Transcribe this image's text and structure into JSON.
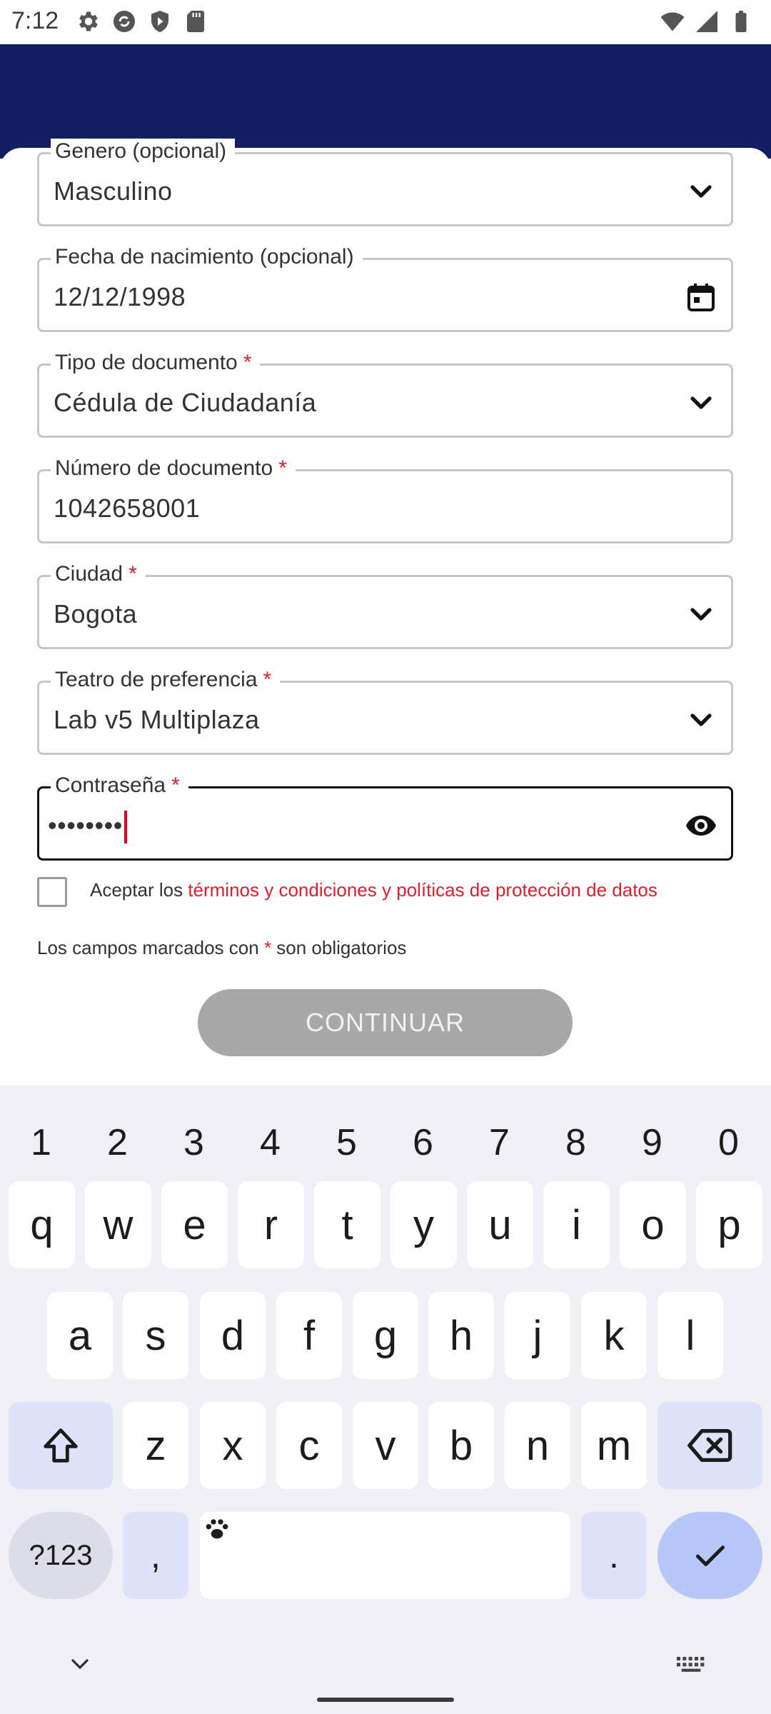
{
  "status_bar": {
    "time": "7:12",
    "left_icons": [
      "settings-icon",
      "sync-icon",
      "shield-icon",
      "sd-card-icon"
    ],
    "right_icons": [
      "wifi-icon",
      "signal-icon",
      "battery-icon"
    ]
  },
  "colors": {
    "header": "#121f63",
    "required": "#e11e2b",
    "button_disabled": "#a8a8a8"
  },
  "form": {
    "fields": [
      {
        "label": "Genero (opcional)",
        "required": false,
        "value": "Masculino",
        "icon": "chevron-down-icon"
      },
      {
        "label": "Fecha de nacimiento (opcional)",
        "required": false,
        "value": "12/12/1998",
        "icon": "calendar-icon"
      },
      {
        "label": "Tipo de documento",
        "required": true,
        "value": "Cédula de Ciudadanía",
        "icon": "chevron-down-icon"
      },
      {
        "label": "Número de documento",
        "required": true,
        "value": "1042658001",
        "icon": ""
      },
      {
        "label": "Ciudad",
        "required": true,
        "value": "Bogota",
        "icon": "chevron-down-icon"
      },
      {
        "label": "Teatro de preferencia",
        "required": true,
        "value": "Lab v5 Multiplaza",
        "icon": "chevron-down-icon"
      },
      {
        "label": "Contraseña",
        "required": true,
        "value": "••••••••",
        "icon": "eye-icon"
      }
    ],
    "required_mark": "*",
    "terms_prefix": "Aceptar los ",
    "terms_link": "términos y condiciones y políticas de protección de datos",
    "terms_checked": false,
    "note_prefix": "Los campos marcados con ",
    "note_suffix": " son obligatorios",
    "continue_label": "CONTINUAR"
  },
  "keyboard": {
    "number_row": [
      "1",
      "2",
      "3",
      "4",
      "5",
      "6",
      "7",
      "8",
      "9",
      "0"
    ],
    "row1": [
      "q",
      "w",
      "e",
      "r",
      "t",
      "y",
      "u",
      "i",
      "o",
      "p"
    ],
    "row2": [
      "a",
      "s",
      "d",
      "f",
      "g",
      "h",
      "j",
      "k",
      "l"
    ],
    "row3": [
      "z",
      "x",
      "c",
      "v",
      "b",
      "n",
      "m"
    ],
    "symbols_label": "?123",
    "comma": ",",
    "period": "."
  }
}
